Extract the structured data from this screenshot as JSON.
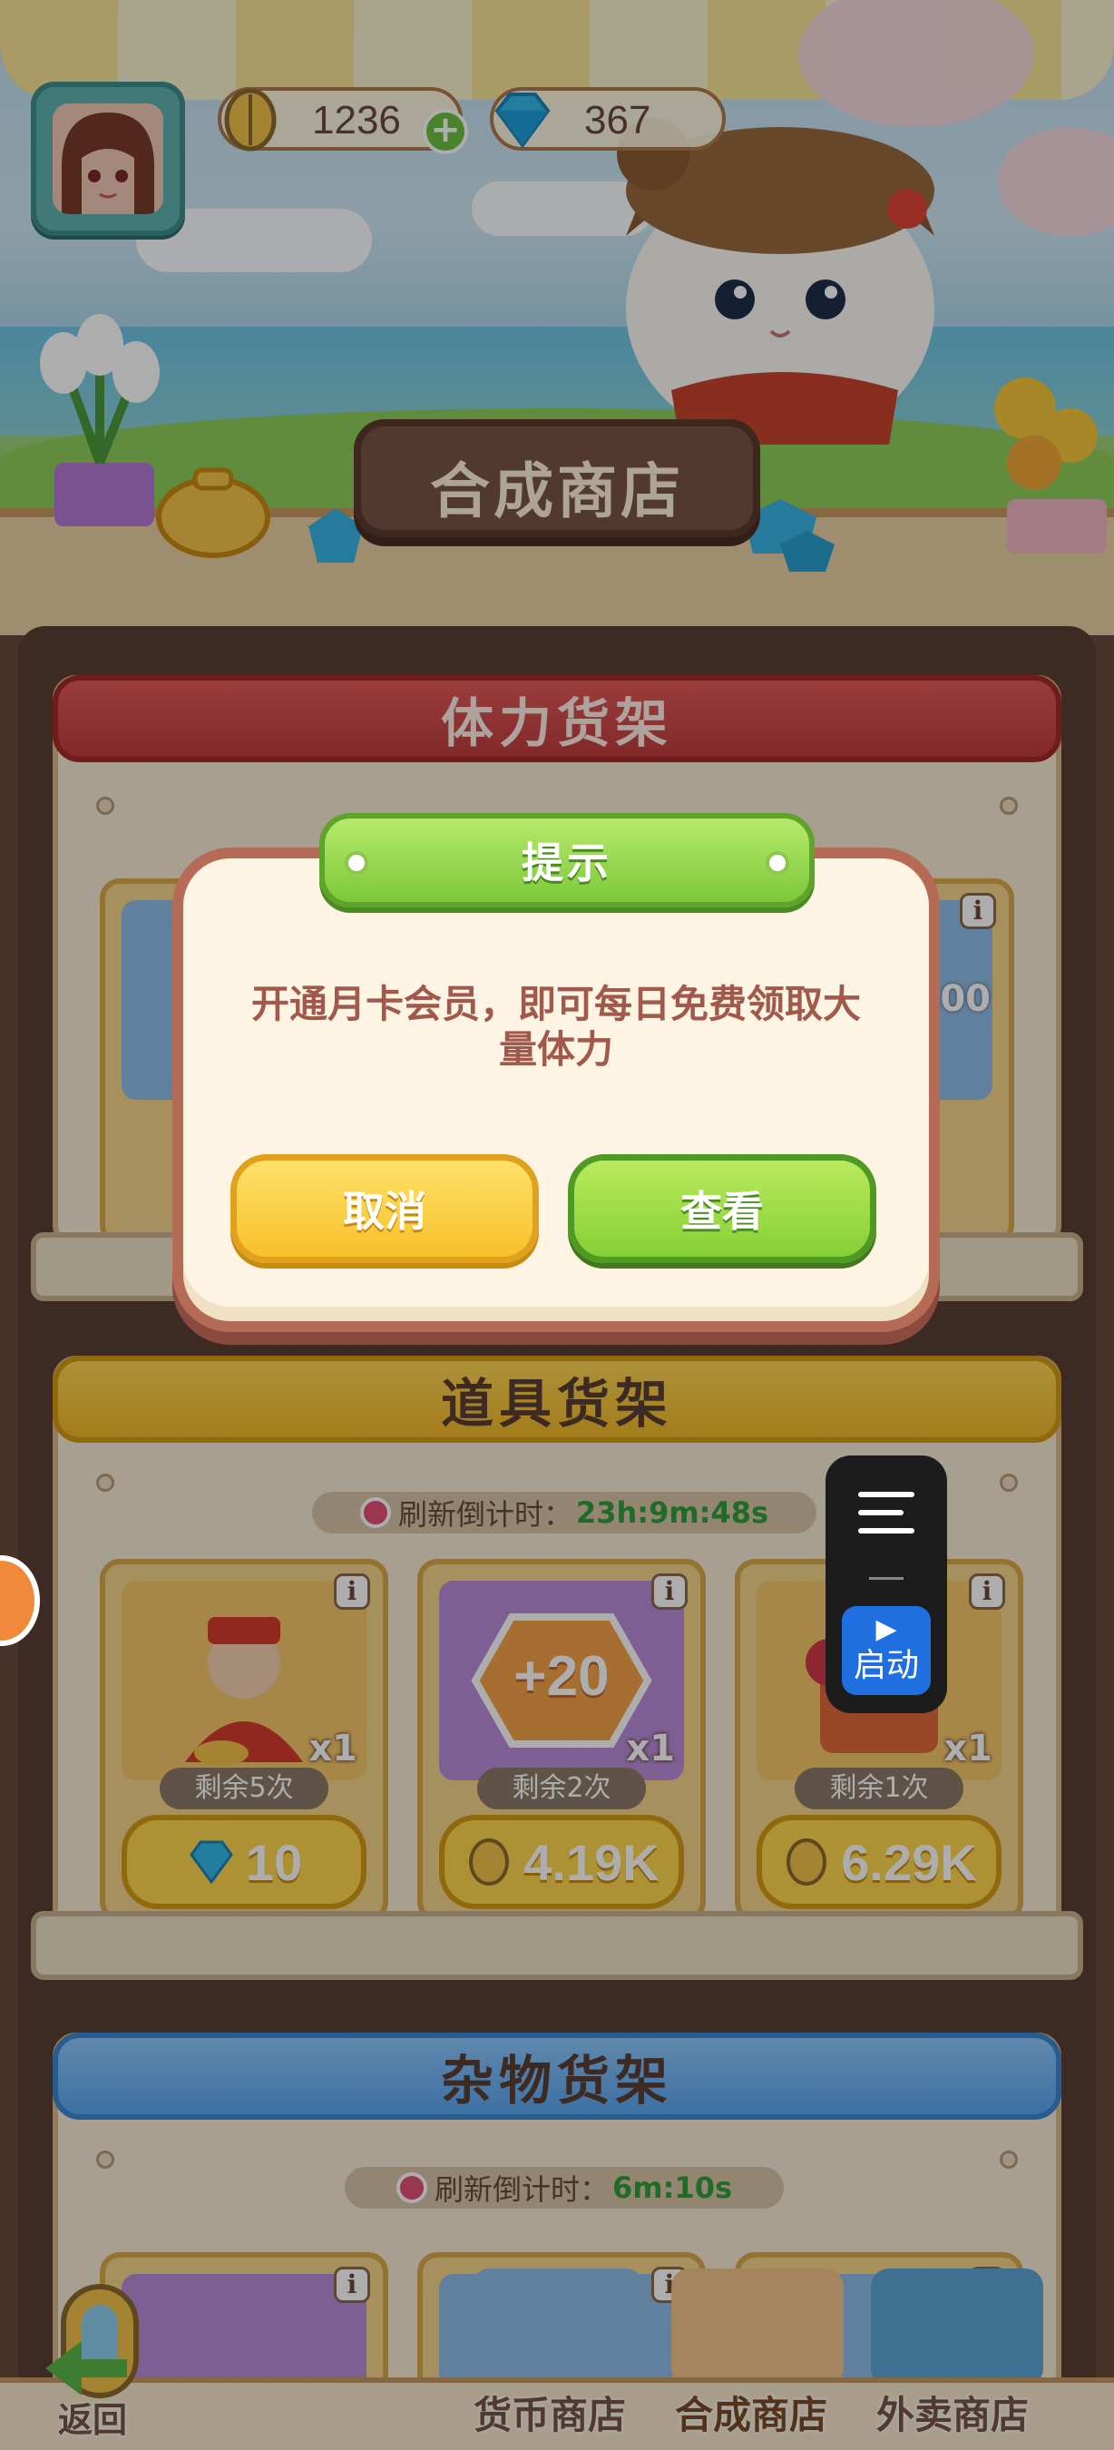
{
  "top_bar": {
    "coins": "1236",
    "gems": "367",
    "add_label": "+"
  },
  "shop_title": "合成商店",
  "shelves": {
    "stamina": {
      "title": "体力货架",
      "partial_price": "00"
    },
    "props": {
      "title": "道具货架",
      "timer_label": "刷新倒计时：",
      "timer_value": "23h:9m:48s",
      "items": [
        {
          "qty": "x1",
          "remain": "剩余5次",
          "price": "10",
          "currency": "gem"
        },
        {
          "qty": "x1",
          "badge": "+20",
          "remain": "剩余2次",
          "price": "4.19K",
          "currency": "seed"
        },
        {
          "qty": "x1",
          "remain": "剩余1次",
          "price": "6.29K",
          "currency": "seed"
        }
      ]
    },
    "misc": {
      "title": "杂物货架",
      "timer_label": "刷新倒计时：",
      "timer_value": "6m:10s"
    }
  },
  "dialog": {
    "title": "提示",
    "message": "开通月卡会员，即可每日免费领取大量体力",
    "cancel_label": "取消",
    "view_label": "查看"
  },
  "float_widget": {
    "start_label": "启动"
  },
  "bottom_nav": {
    "back_label": "返回",
    "items": [
      "货币商店",
      "合成商店",
      "外卖商店"
    ],
    "active": "合成商店"
  },
  "colors": {
    "dialog_border": "#b66b57",
    "cancel_button": "#f7c02b",
    "view_button": "#86cf37",
    "timer_green": "#2f9e3a"
  }
}
